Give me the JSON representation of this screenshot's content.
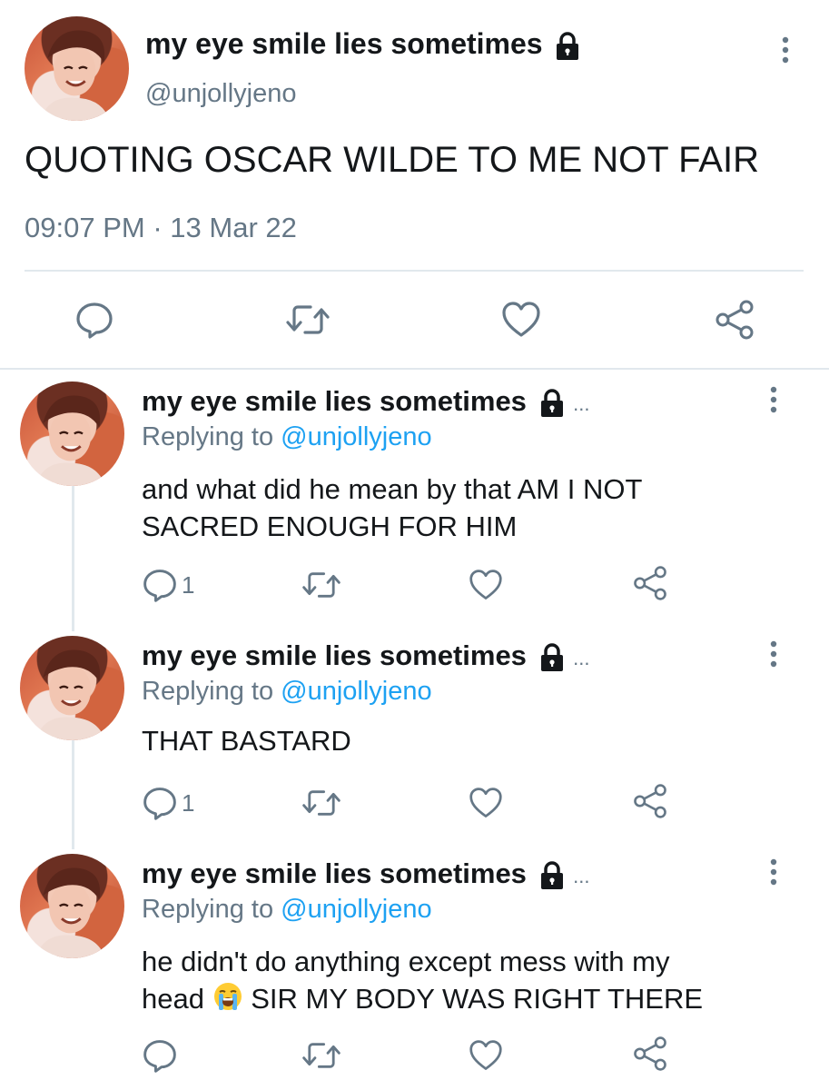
{
  "main_tweet": {
    "display_name": "my eye smile lies sometimes",
    "handle": "@unjollyjeno",
    "text": "QUOTING OSCAR WILDE TO ME NOT FAIR",
    "time": "09:07 PM",
    "separator": "·",
    "date": "13 Mar 22"
  },
  "replies": [
    {
      "display_name": "my eye smile lies sometimes",
      "ellipsis": "...",
      "replying_to_prefix": "Replying to",
      "replying_to_handle": "@unjollyjeno",
      "text_line1": "and what did he mean by that AM I NOT",
      "text_line2": "SACRED ENOUGH FOR HIM",
      "reply_count": "1"
    },
    {
      "display_name": "my eye smile lies sometimes",
      "ellipsis": "...",
      "replying_to_prefix": "Replying to",
      "replying_to_handle": "@unjollyjeno",
      "text_line1": "THAT BASTARD",
      "text_line2": "",
      "reply_count": "1"
    },
    {
      "display_name": "my eye smile lies sometimes",
      "ellipsis": "...",
      "replying_to_prefix": "Replying to",
      "replying_to_handle": "@unjollyjeno",
      "text_line1": "he didn't do anything except mess with my",
      "text_line2_a": "head",
      "text_line2_b": "SIR MY BODY WAS RIGHT THERE",
      "reply_count": ""
    }
  ],
  "icons": {
    "lock": "lock-icon",
    "more": "more-vertical-icon",
    "reply": "reply-icon",
    "retweet": "retweet-icon",
    "like": "like-icon",
    "share": "share-icon",
    "emoji": "loudly-crying-face"
  },
  "colors": {
    "text": "#14171a",
    "secondary": "#657786",
    "mention": "#1da1f2",
    "divider": "#e1e8ed"
  }
}
